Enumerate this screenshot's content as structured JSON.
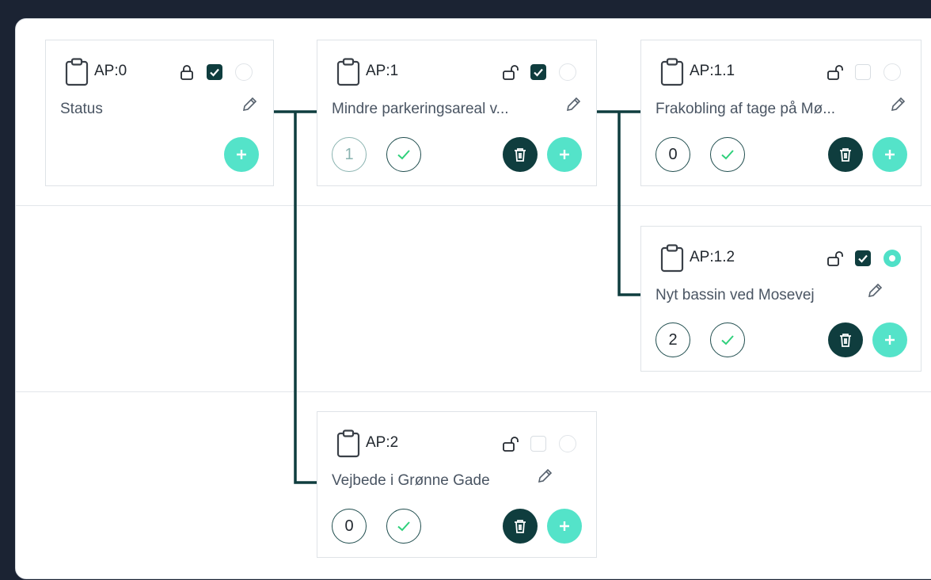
{
  "cards": {
    "ap0": {
      "id": "AP:0",
      "title": "Status",
      "locked": true,
      "checked": true,
      "selected": false
    },
    "ap1": {
      "id": "AP:1",
      "title": "Mindre parkeringsareal v...",
      "count": "1",
      "locked": false,
      "checked": true,
      "selected": false
    },
    "ap11": {
      "id": "AP:1.1",
      "title": "Frakobling af tage på Mø...",
      "count": "0",
      "locked": false,
      "checked": false,
      "selected": false
    },
    "ap12": {
      "id": "AP:1.2",
      "title": "Nyt bassin ved Mosevej",
      "count": "2",
      "locked": false,
      "checked": true,
      "selected": true
    },
    "ap2": {
      "id": "AP:2",
      "title": "Vejbede i Grønne Gade",
      "count": "0",
      "locked": false,
      "checked": false,
      "selected": false
    }
  },
  "icons": {
    "clipboard": "clipboard-icon",
    "lock": "lock-icon",
    "unlock": "unlock-icon",
    "pencil": "pencil-icon",
    "check": "check-icon",
    "trash": "trash-icon",
    "plus": "plus-icon"
  },
  "colors": {
    "background": "#1b2333",
    "dark_teal": "#0f3d3e",
    "accent_teal": "#54e3c9",
    "check_green": "#2fd07b",
    "connector": "#0f3d3e"
  }
}
